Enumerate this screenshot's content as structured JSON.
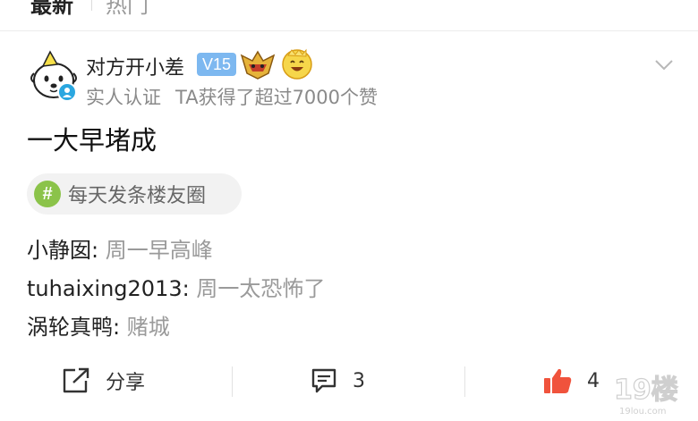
{
  "tabs": {
    "latest": "最新",
    "hot": "热门"
  },
  "post": {
    "author": "对方开小差",
    "level_badge": "V15",
    "verification": "实人认证",
    "likes_summary": "TA获得了超过7000个赞",
    "title": "一大早堵成",
    "topic": {
      "icon": "#",
      "label": "每天发条楼友圈"
    }
  },
  "comments": [
    {
      "author": "小静囡: ",
      "text": "周一早高峰"
    },
    {
      "author": "tuhaixing2013: ",
      "text": "周一太恐怖了"
    },
    {
      "author": "涡轮真鸭: ",
      "text": "赌城"
    }
  ],
  "actions": {
    "share_label": "分享",
    "reply_count": "3",
    "like_count": "4"
  },
  "watermark": "19楼",
  "colors": {
    "level_badge": "#7db8f0",
    "topic_icon": "#8bc34a",
    "like": "#f0533c",
    "verify": "#2aa7e0"
  }
}
